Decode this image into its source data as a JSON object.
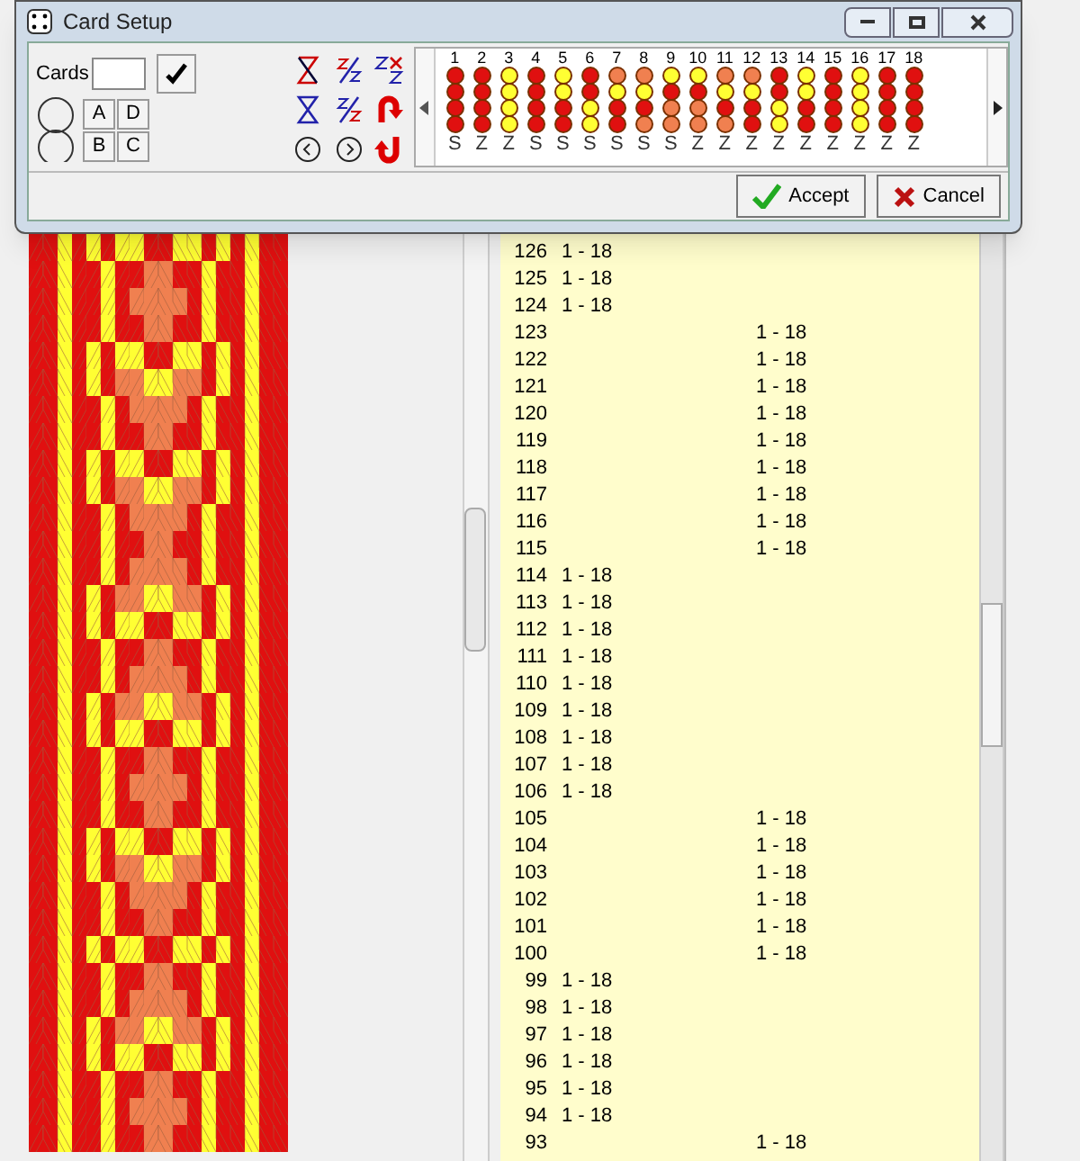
{
  "dialog": {
    "title": "Card Setup",
    "cards_label": "Cards",
    "position_buttons": [
      "A",
      "D",
      "B",
      "C"
    ],
    "cards": [
      {
        "number": "1",
        "holes": [
          {
            "color": "#e01010"
          },
          {
            "color": "#e01010"
          },
          {
            "color": "#e01010"
          },
          {
            "color": "#e01010"
          }
        ],
        "threading": "S"
      },
      {
        "number": "2",
        "holes": [
          {
            "color": "#e01010"
          },
          {
            "color": "#e01010"
          },
          {
            "color": "#e01010"
          },
          {
            "color": "#e01010"
          }
        ],
        "threading": "Z"
      },
      {
        "number": "3",
        "holes": [
          {
            "color": "#ffff33"
          },
          {
            "color": "#ffff33"
          },
          {
            "color": "#ffff33"
          },
          {
            "color": "#ffff33"
          }
        ],
        "threading": "Z"
      },
      {
        "number": "4",
        "holes": [
          {
            "color": "#e01010"
          },
          {
            "color": "#e01010"
          },
          {
            "color": "#e01010"
          },
          {
            "color": "#e01010"
          }
        ],
        "threading": "S"
      },
      {
        "number": "5",
        "holes": [
          {
            "color": "#ffff33"
          },
          {
            "color": "#ffff33"
          },
          {
            "color": "#e01010"
          },
          {
            "color": "#e01010"
          }
        ],
        "threading": "S"
      },
      {
        "number": "6",
        "holes": [
          {
            "color": "#e01010"
          },
          {
            "color": "#e01010"
          },
          {
            "color": "#ffff33"
          },
          {
            "color": "#ffff33"
          }
        ],
        "threading": "S"
      },
      {
        "number": "7",
        "holes": [
          {
            "color": "#f08050"
          },
          {
            "color": "#ffff33"
          },
          {
            "color": "#e01010"
          },
          {
            "color": "#e01010"
          }
        ],
        "threading": "S"
      },
      {
        "number": "8",
        "holes": [
          {
            "color": "#f08050"
          },
          {
            "color": "#ffff33"
          },
          {
            "color": "#e01010"
          },
          {
            "color": "#f08050"
          }
        ],
        "threading": "S"
      },
      {
        "number": "9",
        "holes": [
          {
            "color": "#ffff33"
          },
          {
            "color": "#e01010"
          },
          {
            "color": "#f08050"
          },
          {
            "color": "#f08050"
          }
        ],
        "threading": "S"
      },
      {
        "number": "10",
        "holes": [
          {
            "color": "#ffff33"
          },
          {
            "color": "#e01010"
          },
          {
            "color": "#f08050"
          },
          {
            "color": "#f08050"
          }
        ],
        "threading": "Z"
      },
      {
        "number": "11",
        "holes": [
          {
            "color": "#f08050"
          },
          {
            "color": "#ffff33"
          },
          {
            "color": "#e01010"
          },
          {
            "color": "#f08050"
          }
        ],
        "threading": "Z"
      },
      {
        "number": "12",
        "holes": [
          {
            "color": "#f08050"
          },
          {
            "color": "#ffff33"
          },
          {
            "color": "#e01010"
          },
          {
            "color": "#e01010"
          }
        ],
        "threading": "Z"
      },
      {
        "number": "13",
        "holes": [
          {
            "color": "#e01010"
          },
          {
            "color": "#e01010"
          },
          {
            "color": "#ffff33"
          },
          {
            "color": "#ffff33"
          }
        ],
        "threading": "Z"
      },
      {
        "number": "14",
        "holes": [
          {
            "color": "#ffff33"
          },
          {
            "color": "#ffff33"
          },
          {
            "color": "#e01010"
          },
          {
            "color": "#e01010"
          }
        ],
        "threading": "Z"
      },
      {
        "number": "15",
        "holes": [
          {
            "color": "#e01010"
          },
          {
            "color": "#e01010"
          },
          {
            "color": "#e01010"
          },
          {
            "color": "#e01010"
          }
        ],
        "threading": "Z"
      },
      {
        "number": "16",
        "holes": [
          {
            "color": "#ffff33"
          },
          {
            "color": "#ffff33"
          },
          {
            "color": "#ffff33"
          },
          {
            "color": "#ffff33"
          }
        ],
        "threading": "Z"
      },
      {
        "number": "17",
        "holes": [
          {
            "color": "#e01010"
          },
          {
            "color": "#e01010"
          },
          {
            "color": "#e01010"
          },
          {
            "color": "#e01010"
          }
        ],
        "threading": "Z"
      },
      {
        "number": "18",
        "holes": [
          {
            "color": "#e01010"
          },
          {
            "color": "#e01010"
          },
          {
            "color": "#e01010"
          },
          {
            "color": "#e01010"
          }
        ],
        "threading": "Z"
      }
    ],
    "buttons": [
      "Accept",
      "Cancel"
    ]
  },
  "turning_list": [
    {
      "number": "126",
      "column_2": "1 - 18"
    },
    {
      "number": "125",
      "column_2": "1 - 18"
    },
    {
      "number": "124",
      "column_2": "1 - 18"
    },
    {
      "number": "123",
      "column_3": "1 - 18"
    },
    {
      "number": "122",
      "column_3": "1 - 18"
    },
    {
      "number": "121",
      "column_3": "1 - 18"
    },
    {
      "number": "120",
      "column_3": "1 - 18"
    },
    {
      "number": "119",
      "column_3": "1 - 18"
    },
    {
      "number": "118",
      "column_3": "1 - 18"
    },
    {
      "number": "117",
      "column_3": "1 - 18"
    },
    {
      "number": "116",
      "column_3": "1 - 18"
    },
    {
      "number": "115",
      "column_3": "1 - 18"
    },
    {
      "number": "114",
      "column_2": "1 - 18"
    },
    {
      "number": "113",
      "column_2": "1 - 18"
    },
    {
      "number": "112",
      "column_2": "1 - 18"
    },
    {
      "number": "111",
      "column_2": "1 - 18"
    },
    {
      "number": "110",
      "column_2": "1 - 18"
    },
    {
      "number": "109",
      "column_2": "1 - 18"
    },
    {
      "number": "108",
      "column_2": "1 - 18"
    },
    {
      "number": "107",
      "column_2": "1 - 18"
    },
    {
      "number": "106",
      "column_2": "1 - 18"
    },
    {
      "number": "105",
      "column_3": "1 - 18"
    },
    {
      "number": "104",
      "column_3": "1 - 18"
    },
    {
      "number": "103",
      "column_3": "1 - 18"
    },
    {
      "number": "102",
      "column_3": "1 - 18"
    },
    {
      "number": "101",
      "column_3": "1 - 18"
    },
    {
      "number": "100",
      "column_3": "1 - 18"
    },
    {
      "number": "99",
      "column_2": "1 - 18"
    },
    {
      "number": "98",
      "column_2": "1 - 18"
    },
    {
      "number": "97",
      "column_2": "1 - 18"
    },
    {
      "number": "96",
      "column_2": "1 - 18"
    },
    {
      "number": "95",
      "column_2": "1 - 18"
    },
    {
      "number": "94",
      "column_2": "1 - 18"
    },
    {
      "number": "93",
      "column_3": "1 - 18"
    }
  ]
}
